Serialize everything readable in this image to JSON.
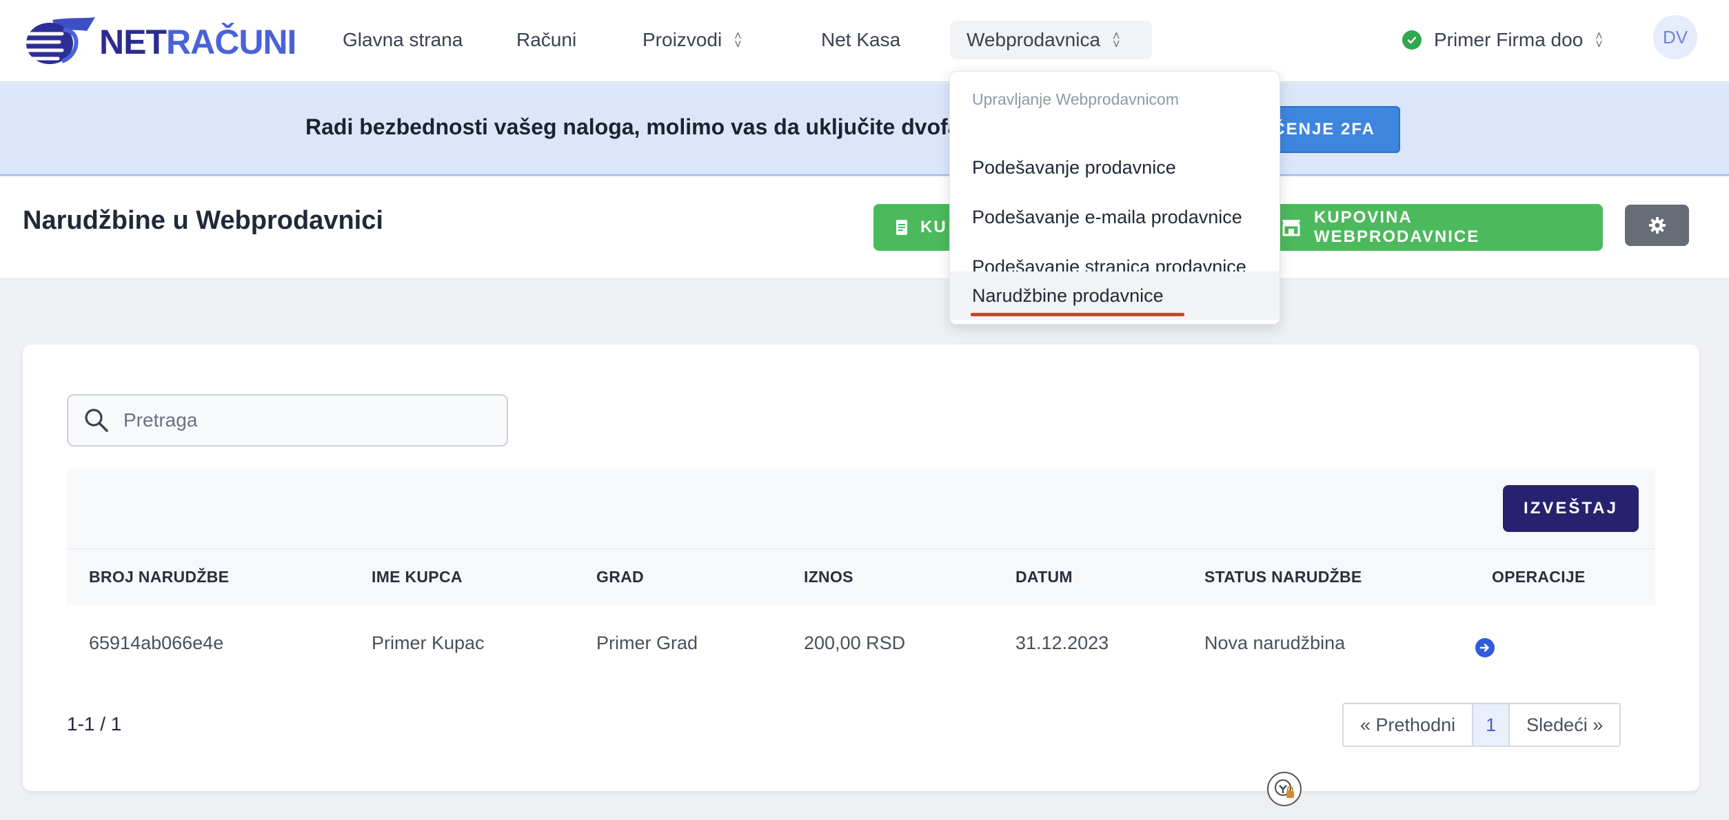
{
  "brand": {
    "part1": "NET",
    "part2": "RAČUNI"
  },
  "nav": [
    {
      "label": "Glavna strana"
    },
    {
      "label": "Računi"
    },
    {
      "label": "Proizvodi"
    },
    {
      "label": "Net Kasa"
    },
    {
      "label": "Webprodavnica"
    }
  ],
  "company": {
    "name": "Primer Firma doo"
  },
  "user": {
    "initials": "DV"
  },
  "banner": {
    "text": "Radi bezbednosti vašeg naloga, molimo vas da uključite dvofakto",
    "button": "ČENJE 2FA"
  },
  "page": {
    "title": "Narudžbine u Webprodavnici",
    "btn_faktura": "KU",
    "btn_kupovina": "KUPOVINA WEBPRODAVNICE"
  },
  "dropdown": {
    "header": "Upravljanje Webprodavnicom",
    "items": [
      {
        "label": "Podešavanje prodavnice"
      },
      {
        "label": "Podešavanje e-maila prodavnice"
      },
      {
        "label": "Podešavanje stranica prodavnice"
      },
      {
        "label": "Narudžbine prodavnice"
      }
    ]
  },
  "search": {
    "placeholder": "Pretraga",
    "value": ""
  },
  "report_button": "IZVEŠTAJ",
  "table": {
    "columns": [
      "BROJ NARUDŽBE",
      "IME KUPCA",
      "GRAD",
      "IZNOS",
      "DATUM",
      "STATUS NARUDŽBE",
      "OPERACIJE"
    ],
    "rows": [
      [
        "65914ab066e4e",
        "Primer Kupac",
        "Primer Grad",
        "200,00 RSD",
        "31.12.2023",
        "Nova narudžbina"
      ]
    ]
  },
  "pagination": {
    "summary": "1-1 / 1",
    "prev": "« Prethodni",
    "current": "1",
    "next": "Sledeći »"
  },
  "colors": {
    "accent_navy": "#26226e",
    "green": "#4cb95c",
    "banner_bg": "#dbe6fb",
    "active_underline": "#e23b2c"
  }
}
